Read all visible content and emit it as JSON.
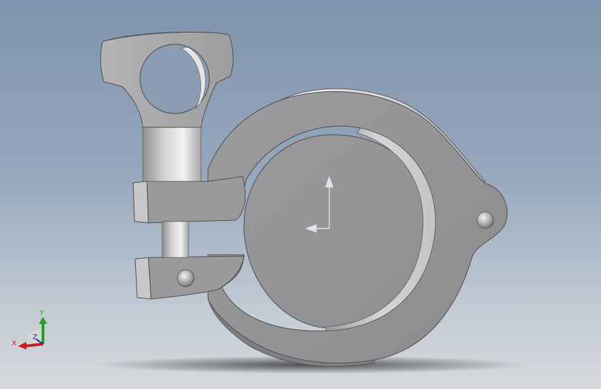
{
  "viewport": {
    "background_top": "#7e93ad",
    "background_bottom": "#d6dadd",
    "model": "tri-clamp-with-wing-nut",
    "part_color": "#a2a2a4"
  },
  "triad": {
    "x_label": "X",
    "y_label": "Y",
    "z_label": "Z",
    "x_color": "#c81e1e",
    "y_color": "#1fa11f",
    "z_color": "#2a2ab8"
  },
  "origin_marker": {
    "icon": "origin-arrows-icon"
  }
}
